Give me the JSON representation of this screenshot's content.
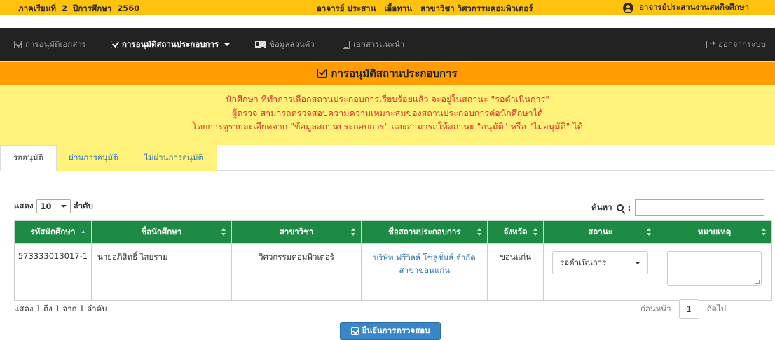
{
  "topbar": {
    "semester": "ภาคเรียนที่  2  ปีการศึกษา  2560",
    "advisor": "อาจารย์ ประสาน   เอื้อทาน   สาขาวิชา วิศวกรรมคอมพิวเตอร์",
    "role": "อาจารย์ประสานงานสหกิจศึกษา",
    "bg_color": "#ffc20e"
  },
  "nav": {
    "items": [
      {
        "label": "การอนุมัติเอกสาร",
        "icon": "check-square-icon"
      },
      {
        "label": "การอนุมัติสถานประกอบการ",
        "icon": "check-square-icon"
      },
      {
        "label": "ข้อมูลส่วนตัว",
        "icon": "id-card-icon"
      },
      {
        "label": "เอกสารแนะนำ",
        "icon": "document-icon"
      }
    ],
    "logout": "ออกจากระบบ"
  },
  "page": {
    "title": "การอนุมัติสถานประกอบการ",
    "notice_lines": [
      "นักศึกษา ที่ทำการเลือกสถานประกอบการเรียบร้อยแล้ว จะอยู่ในสถานะ \"รอดำเนินการ\"",
      "ผู้ตรวจ สามารถตรวจสอบความความเหมาะสมของสถานประกอบการต่อนักศึกษาได้",
      "โดยการดูรายละเอียดจาก \"ข้อมูลสถานประกอบการ\" และสามารถให้สถานะ \"อนุมัติ\" หรือ \"ไม่อนุมัติ\" ได้"
    ]
  },
  "tabs": [
    "รออนุมัติ",
    "ผ่านการอนุมัติ",
    "ไม่ผ่านการอนุมัติ"
  ],
  "table_controls": {
    "show_label": "แสดง",
    "page_size": "10",
    "unit_label": "ลำดับ",
    "search_label": "ค้นหา",
    "search_colon": ":",
    "search_value": ""
  },
  "table": {
    "columns": [
      "รหัสนักศึกษา",
      "ชื่อนักศึกษา",
      "สาขาวิชา",
      "ชื่อสถานประกอบการ",
      "จังหวัด",
      "สถานะ",
      "หมายเหตุ"
    ],
    "rows": [
      {
        "student_id": "573333013017-1",
        "student_name": "นายอภิสิทธิ์  ไสยราม",
        "major": "วิศวกรรมคอมพิวเตอร์",
        "company": "บริษัท ฟรีวิลล์ โซลูชั่นส์ จำกัด สาขาขอนแก่น",
        "province": "ขอนแก่น",
        "status": "รอดำเนินการ",
        "note": ""
      }
    ]
  },
  "footer": {
    "info": "แสดง 1 ถึง 1 จาก 1 ลำดับ",
    "prev": "ก่อนหน้า",
    "page": "1",
    "next": "ถัดไป",
    "confirm": "ยืนยันการตรวจสอบ"
  }
}
